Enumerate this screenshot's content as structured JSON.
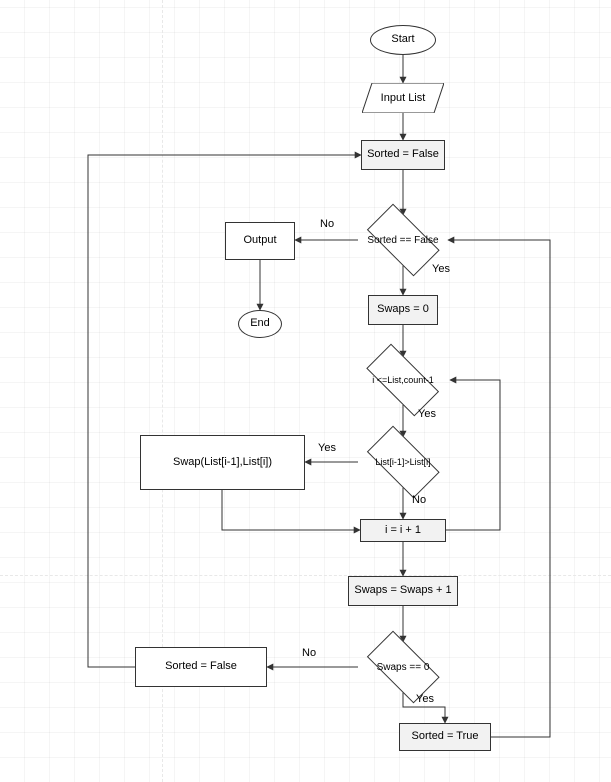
{
  "chart_data": {
    "type": "flowchart",
    "title": "Bubble Sort Flowchart",
    "nodes": [
      {
        "id": "start",
        "type": "terminator",
        "label": "Start"
      },
      {
        "id": "input",
        "type": "io",
        "label": "Input  List"
      },
      {
        "id": "init_sorted",
        "type": "process",
        "label": "Sorted = False"
      },
      {
        "id": "check_sorted",
        "type": "decision",
        "label": "Sorted == False"
      },
      {
        "id": "output",
        "type": "process",
        "label": "Output"
      },
      {
        "id": "end",
        "type": "terminator",
        "label": "End"
      },
      {
        "id": "init_swaps",
        "type": "process",
        "label": "Swaps = 0"
      },
      {
        "id": "check_i",
        "type": "decision",
        "label": "i <=List,count-1"
      },
      {
        "id": "compare",
        "type": "decision",
        "label": "List[i-1]>List[i]"
      },
      {
        "id": "swap",
        "type": "process",
        "label": "Swap(List[i-1],List[i])"
      },
      {
        "id": "inc_i",
        "type": "process",
        "label": "i = i + 1"
      },
      {
        "id": "inc_swaps",
        "type": "process",
        "label": "Swaps =  Swaps + 1"
      },
      {
        "id": "check_swaps",
        "type": "decision",
        "label": "Swaps == 0"
      },
      {
        "id": "set_false",
        "type": "process",
        "label": "Sorted = False"
      },
      {
        "id": "set_true",
        "type": "process",
        "label": "Sorted = True"
      }
    ],
    "edges": [
      {
        "from": "start",
        "to": "input",
        "label": ""
      },
      {
        "from": "input",
        "to": "init_sorted",
        "label": ""
      },
      {
        "from": "init_sorted",
        "to": "check_sorted",
        "label": ""
      },
      {
        "from": "check_sorted",
        "to": "output",
        "label": "No"
      },
      {
        "from": "check_sorted",
        "to": "init_swaps",
        "label": "Yes"
      },
      {
        "from": "output",
        "to": "end",
        "label": ""
      },
      {
        "from": "init_swaps",
        "to": "check_i",
        "label": ""
      },
      {
        "from": "check_i",
        "to": "compare",
        "label": "Yes"
      },
      {
        "from": "compare",
        "to": "swap",
        "label": "Yes"
      },
      {
        "from": "compare",
        "to": "inc_i",
        "label": "No"
      },
      {
        "from": "swap",
        "to": "inc_i",
        "label": ""
      },
      {
        "from": "inc_i",
        "to": "check_i",
        "label": ""
      },
      {
        "from": "inc_i",
        "to": "inc_swaps",
        "label": ""
      },
      {
        "from": "inc_swaps",
        "to": "check_swaps",
        "label": ""
      },
      {
        "from": "check_swaps",
        "to": "set_false",
        "label": "No"
      },
      {
        "from": "check_swaps",
        "to": "set_true",
        "label": "Yes"
      },
      {
        "from": "set_true",
        "to": "check_sorted",
        "label": ""
      },
      {
        "from": "set_false",
        "to": "init_sorted",
        "label": ""
      }
    ]
  },
  "nodes": {
    "start": "Start",
    "input": "Input  List",
    "init_sorted": "Sorted = False",
    "check_sorted": "Sorted == False",
    "output": "Output",
    "end": "End",
    "init_swaps": "Swaps = 0",
    "check_i": "i <=List,count-1",
    "compare": "List[i-1]>List[i]",
    "swap": "Swap(List[i-1],List[i])",
    "inc_i": "i = i + 1",
    "inc_swaps": "Swaps =  Swaps + 1",
    "check_swaps": "Swaps == 0",
    "set_false": "Sorted = False",
    "set_true": "Sorted = True"
  },
  "labels": {
    "yes": "Yes",
    "no": "No"
  }
}
